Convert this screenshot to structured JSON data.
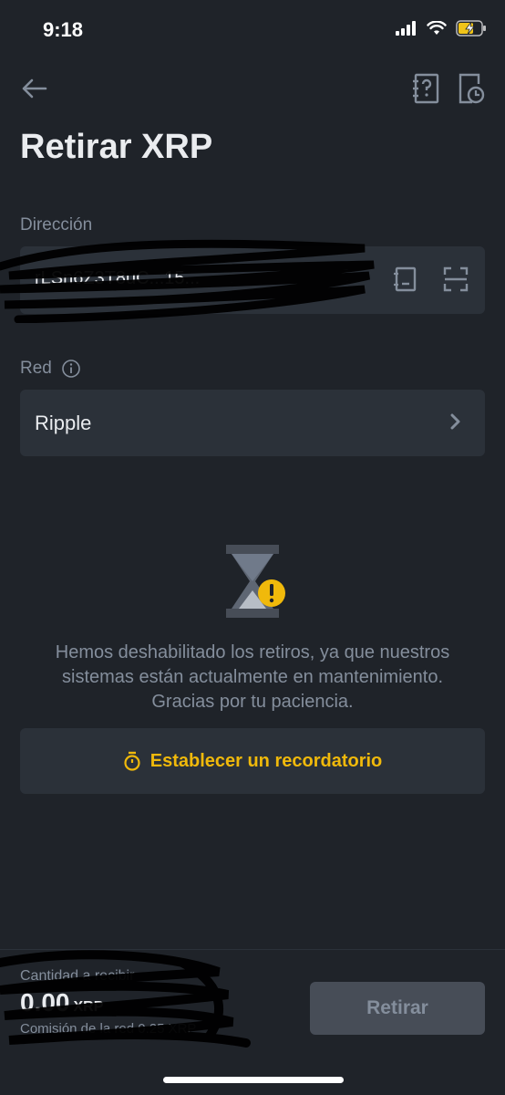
{
  "status_bar": {
    "time": "9:18"
  },
  "page": {
    "title": "Retirar XRP"
  },
  "address": {
    "label": "Dirección",
    "value": "rLSn6Z3T8uC...15..."
  },
  "network": {
    "label": "Red",
    "value": "Ripple"
  },
  "notice": {
    "text": "Hemos deshabilitado los retiros, ya que nuestros sistemas están actualmente en mantenimiento. Gracias por tu paciencia."
  },
  "reminder": {
    "label": "Establecer un recordatorio"
  },
  "footer": {
    "receive_label": "Cantidad a recibir",
    "amount": "0.00",
    "unit": "XRP",
    "fee": "Comisión de la red 0.25 XRP",
    "withdraw_label": "Retirar"
  },
  "colors": {
    "background": "#1f2329",
    "accent": "#f0b90b",
    "surface": "#2b3139"
  }
}
